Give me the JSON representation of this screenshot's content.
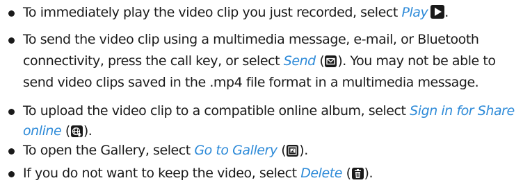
{
  "items": [
    {
      "lines": [
        {
          "before": "To immediately play the video clip you just recorded, select ",
          "link": "Play",
          "after": "."
        }
      ],
      "icon": "play-icon"
    },
    {
      "lines": [
        {
          "text": "To send the video clip using a multimedia message, e-mail, or Bluetooth"
        },
        {
          "before": "connectivity, press the call key, or select ",
          "link": "Send",
          "paren_open": " (",
          "paren_close": "). You may not be able to"
        },
        {
          "text": "send video clips saved in the .mp4 file format in a multimedia message."
        }
      ],
      "icon": "envelope-icon"
    },
    {
      "lines": [
        {
          "before": "To upload the video clip to a compatible online album, select ",
          "link": "Sign in for Share"
        },
        {
          "link": "online",
          "paren_open": " (",
          "paren_close": ")."
        }
      ],
      "icon": "globe-upload-icon"
    },
    {
      "lines": [
        {
          "before": "To open the Gallery, select ",
          "link": "Go to Gallery",
          "paren_open": " (",
          "paren_close": ")."
        }
      ],
      "icon": "gallery-icon"
    },
    {
      "lines": [
        {
          "before": "If you do not want to keep the video, select ",
          "link": "Delete",
          "paren_open": " (",
          "paren_close": ")."
        }
      ],
      "icon": "trash-icon"
    }
  ]
}
